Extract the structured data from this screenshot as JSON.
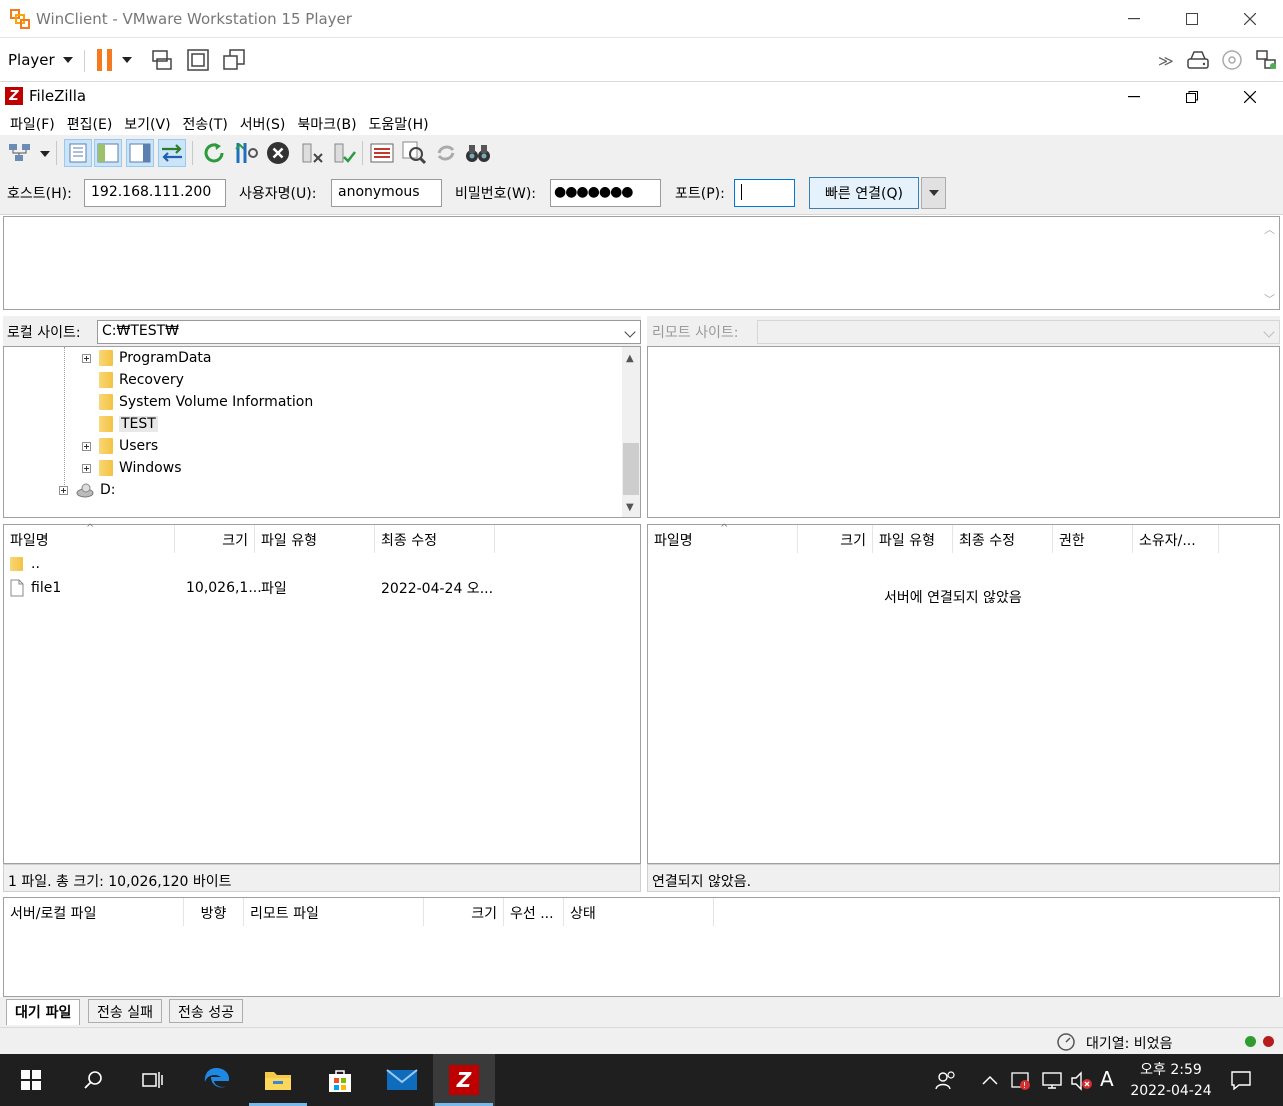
{
  "vmware": {
    "title": "WinClient - VMware Workstation 15 Player",
    "player_menu_label": "Player",
    "window_controls": {
      "minimize": "—",
      "maximize": "☐",
      "close": "✕"
    }
  },
  "filezilla": {
    "title": "FileZilla",
    "menu": [
      "파일(F)",
      "편집(E)",
      "보기(V)",
      "전송(T)",
      "서버(S)",
      "북마크(B)",
      "도움말(H)"
    ],
    "quickconnect": {
      "host_label": "호스트(H):",
      "host_value": "192.168.111.200",
      "user_label": "사용자명(U):",
      "user_value": "anonymous",
      "pass_label": "비밀번호(W):",
      "pass_value": "●●●●●●●",
      "port_label": "포트(P):",
      "port_value": "",
      "connect_button": "빠른 연결(Q)"
    },
    "local": {
      "site_label": "로컬 사이트:",
      "site_path": "C:₩TEST₩",
      "tree": [
        {
          "name": "ProgramData",
          "expandable": true
        },
        {
          "name": "Recovery",
          "expandable": false
        },
        {
          "name": "System Volume Information",
          "expandable": false
        },
        {
          "name": "TEST",
          "expandable": false,
          "selected": true
        },
        {
          "name": "Users",
          "expandable": true
        },
        {
          "name": "Windows",
          "expandable": true
        }
      ],
      "drive": "D:",
      "columns": [
        "파일명",
        "크기",
        "파일 유형",
        "최종 수정"
      ],
      "files": [
        {
          "name": "..",
          "size": "",
          "type": "",
          "modified": ""
        },
        {
          "name": "file1",
          "size": "10,026,1...",
          "type": "파일",
          "modified": "2022-04-24 오..."
        }
      ],
      "status": "1 파일. 총 크기: 10,026,120 바이트"
    },
    "remote": {
      "site_label": "리모트 사이트:",
      "columns": [
        "파일명",
        "크기",
        "파일 유형",
        "최종 수정",
        "권한",
        "소유자/..."
      ],
      "empty_message": "서버에 연결되지 않았음",
      "status": "연결되지 않았음."
    },
    "queue": {
      "columns": [
        "서버/로컬 파일",
        "방향",
        "리모트 파일",
        "크기",
        "우선 ...",
        "상태"
      ],
      "tabs": [
        "대기 파일",
        "전송 실패",
        "전송 성공"
      ]
    },
    "statusbar": {
      "queue_text": "대기열: 비었음"
    }
  },
  "taskbar": {
    "clock_time": "오후 2:59",
    "clock_date": "2022-04-24",
    "ime": "A"
  },
  "colors": {
    "filezilla_red": "#bf0000",
    "vmware_orange": "#f47920",
    "taskbar": "#1f1f1f",
    "accent_blue": "#0078d7"
  }
}
